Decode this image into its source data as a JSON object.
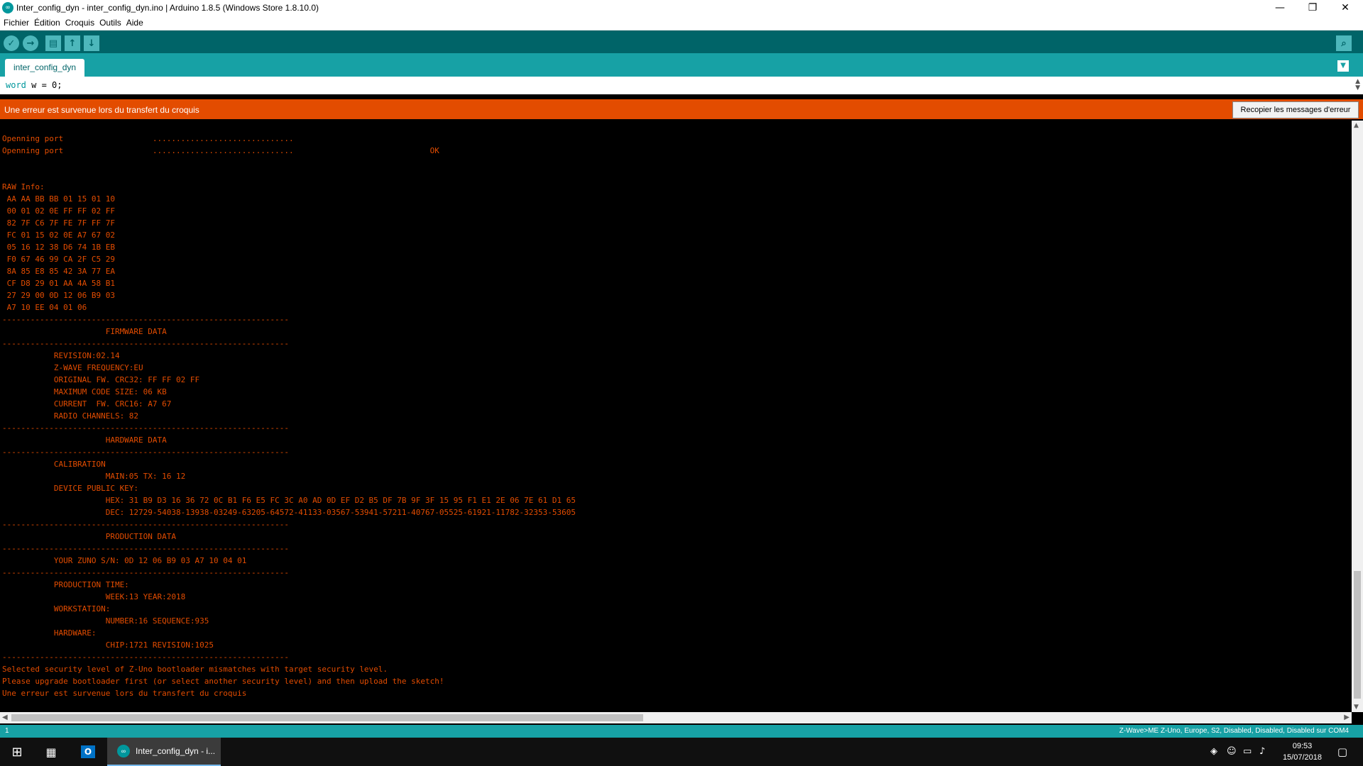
{
  "window": {
    "title": "Inter_config_dyn - inter_config_dyn.ino | Arduino 1.8.5 (Windows Store 1.8.10.0)"
  },
  "menu": [
    "Fichier",
    "Édition",
    "Croquis",
    "Outils",
    "Aide"
  ],
  "toolbar": {
    "verify_glyph": "✓",
    "upload_glyph": "→",
    "new_glyph": "▤",
    "open_glyph": "↑",
    "save_glyph": "↓",
    "monitor_glyph": "⌕"
  },
  "tabs": [
    {
      "label": "inter_config_dyn"
    }
  ],
  "editor": {
    "keyword": "word",
    "rest": " w = 0;"
  },
  "error_bar": {
    "message": "Une erreur est survenue lors du transfert du croquis",
    "copy_button": "Recopier les messages d'erreur"
  },
  "console": [
    "Openning port                   ..............................",
    "Openning port                   ..............................                             OK",
    "",
    "",
    "RAW Info:",
    " AA AA BB BB 01 15 01 10",
    " 00 01 02 0E FF FF 02 FF",
    " 82 7F C6 7F FE 7F FF 7F",
    " FC 01 15 02 0E A7 67 02",
    " 05 16 12 38 D6 74 1B EB",
    " F0 67 46 99 CA 2F C5 29",
    " 8A 85 E8 85 42 3A 77 EA",
    " CF D8 29 01 AA 4A 58 B1",
    " 27 29 00 0D 12 06 B9 03",
    " A7 10 EE 04 01 06",
    "-------------------------------------------------------------",
    "                      FIRMWARE DATA",
    "-------------------------------------------------------------",
    "           REVISION:02.14",
    "           Z-WAVE FREQUENCY:EU",
    "           ORIGINAL FW. CRC32: FF FF 02 FF",
    "           MAXIMUM CODE SIZE: 06 KB",
    "           CURRENT  FW. CRC16: A7 67",
    "           RADIO CHANNELS: 82",
    "-------------------------------------------------------------",
    "                      HARDWARE DATA",
    "-------------------------------------------------------------",
    "           CALIBRATION",
    "                      MAIN:05 TX: 16 12",
    "           DEVICE PUBLIC KEY:",
    "                      HEX: 31 B9 D3 16 36 72 0C B1 F6 E5 FC 3C A0 AD 0D EF D2 B5 DF 7B 9F 3F 15 95 F1 E1 2E 06 7E 61 D1 65",
    "                      DEC: 12729-54038-13938-03249-63205-64572-41133-03567-53941-57211-40767-05525-61921-11782-32353-53605",
    "-------------------------------------------------------------",
    "                      PRODUCTION DATA",
    "-------------------------------------------------------------",
    "           YOUR ZUNO S/N: 0D 12 06 B9 03 A7 10 04 01",
    "-------------------------------------------------------------",
    "           PRODUCTION TIME:",
    "                      WEEK:13 YEAR:2018",
    "           WORKSTATION:",
    "                      NUMBER:16 SEQUENCE:935",
    "           HARDWARE:",
    "                      CHIP:1721 REVISION:1025",
    "-------------------------------------------------------------",
    "Selected security level of Z-Uno bootloader mismatches with target security level.",
    "Please upgrade bootloader first (or select another security level) and then upload the sketch!",
    "Une erreur est survenue lors du transfert du croquis"
  ],
  "status": {
    "line": "1",
    "board": "Z-Wave>ME Z-Uno, Europe, S2, Disabled, Disabled, Disabled sur COM4"
  },
  "taskbar": {
    "app_label": "Inter_config_dyn - i...",
    "time": "09:53",
    "date": "15/07/2018"
  },
  "colors": {
    "toolbar": "#006468",
    "tabbar": "#17A1A5",
    "error": "#E34C00",
    "console_text": "#E34C00"
  }
}
